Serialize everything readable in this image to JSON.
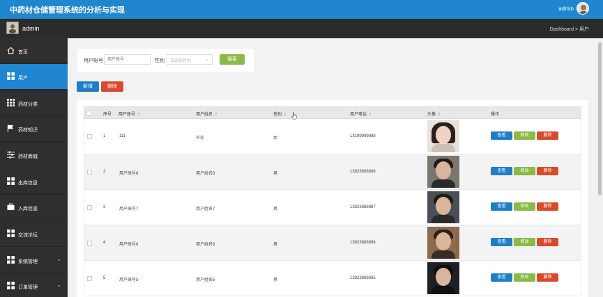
{
  "app": {
    "title": "中药材仓储管理系统的分析与实现",
    "top_user": "admin"
  },
  "subbar": {
    "username": "admin",
    "breadcrumb": "Dashboard > 用户"
  },
  "sidebar": {
    "items": [
      {
        "label": "首页",
        "icon": "home-icon",
        "active": false,
        "chevron": false
      },
      {
        "label": "用户",
        "icon": "grid-icon",
        "active": true,
        "chevron": false
      },
      {
        "label": "药材分类",
        "icon": "list-grid-icon",
        "active": false,
        "chevron": false
      },
      {
        "label": "药材知识",
        "icon": "flag-icon",
        "active": false,
        "chevron": false
      },
      {
        "label": "药材商城",
        "icon": "sliders-icon",
        "active": false,
        "chevron": false
      },
      {
        "label": "出库信息",
        "icon": "grid-icon",
        "active": false,
        "chevron": false
      },
      {
        "label": "入库信息",
        "icon": "briefcase-icon",
        "active": false,
        "chevron": false
      },
      {
        "label": "交流论坛",
        "icon": "grid-icon",
        "active": false,
        "chevron": false
      },
      {
        "label": "系统管理",
        "icon": "grid-icon",
        "active": false,
        "chevron": true
      },
      {
        "label": "订单管理",
        "icon": "grid-icon",
        "active": false,
        "chevron": true
      }
    ]
  },
  "search": {
    "account_label": "用户账号",
    "account_placeholder": "用户账号",
    "gender_label": "性别",
    "gender_placeholder": "请选择性别",
    "search_button": "搜索"
  },
  "actions": {
    "add": "新增",
    "delete": "删除"
  },
  "table": {
    "headers": [
      "序号",
      "用户账号",
      "用户姓名",
      "性别",
      "用户电话",
      "头像",
      "操作"
    ],
    "row_buttons": {
      "view": "查看",
      "edit": "修改",
      "delete": "删除"
    },
    "rows": [
      {
        "index": "1",
        "account": "111",
        "name": "许珍",
        "gender": "女",
        "phone": "13199999888"
      },
      {
        "index": "2",
        "account": "用户账号8",
        "name": "用户姓名8",
        "gender": "男",
        "phone": "13823888888"
      },
      {
        "index": "3",
        "account": "用户账号7",
        "name": "用户姓名7",
        "gender": "男",
        "phone": "13823888887"
      },
      {
        "index": "4",
        "account": "用户账号6",
        "name": "用户姓名6",
        "gender": "男",
        "phone": "13823888886"
      },
      {
        "index": "5",
        "account": "用户账号5",
        "name": "用户姓名5",
        "gender": "男",
        "phone": "13823888885"
      }
    ]
  },
  "colors": {
    "primary": "#1f86cf",
    "sidebar": "#2f2f2f",
    "success": "#8cb947",
    "danger": "#d64b2b"
  }
}
